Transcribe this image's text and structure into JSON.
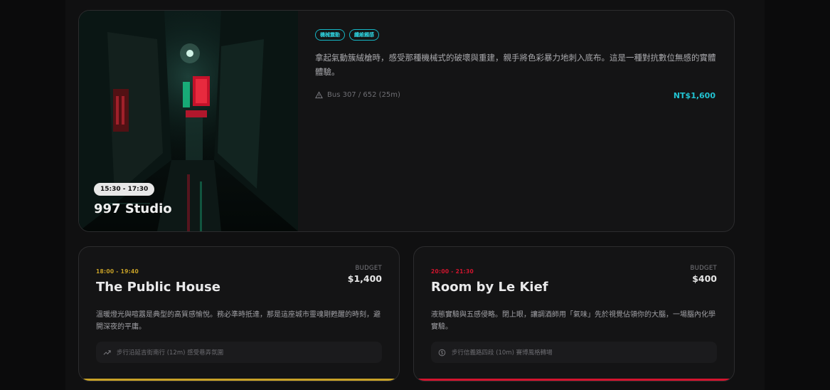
{
  "top_card": {
    "tags": [
      "機械震動",
      "纖維觸感"
    ],
    "description": "拿起氣動簇絨槍時，感受那種機械式的破壞與重建，親手將色彩暴力地刺入底布。這是一種對抗數位無感的實體體驗。",
    "transit": "Bus 307 / 652 (25m)",
    "transit_icon": "warning-triangle-icon",
    "price": "NT$1,600",
    "time": "15:30 - 17:30",
    "venue": "997 Studio"
  },
  "cards": [
    {
      "time": "18:00 - 19:40",
      "title": "The Public House",
      "budget_label": "BUDGET",
      "budget": "$1,400",
      "description": "溫暖燈光與喧囂是典型的高質感愉悅。務必準時抵達，那是這座城市靈魂剛甦醒的時刻，避開深夜的平庸。",
      "route": "步行沿延吉街南行 (12m) 感受巷弄氛圍",
      "route_icon": "trending-up-icon",
      "accent": "#c9a227"
    },
    {
      "time": "20:00 - 21:30",
      "title": "Room by Le Kief",
      "budget_label": "BUDGET",
      "budget": "$400",
      "description": "液態實驗與五感侵略。閉上眼，讓調酒師用「氣味」先於視覺佔領你的大腦，一場腦內化學實驗。",
      "route": "步行信義路四段 (10m) 賽博風格轉場",
      "route_icon": "coin-icon",
      "accent": "#d4142e"
    }
  ],
  "colors": {
    "cyan_accent": "#22c3d2",
    "gold_accent": "#c9a227",
    "red_accent": "#d4142e"
  }
}
